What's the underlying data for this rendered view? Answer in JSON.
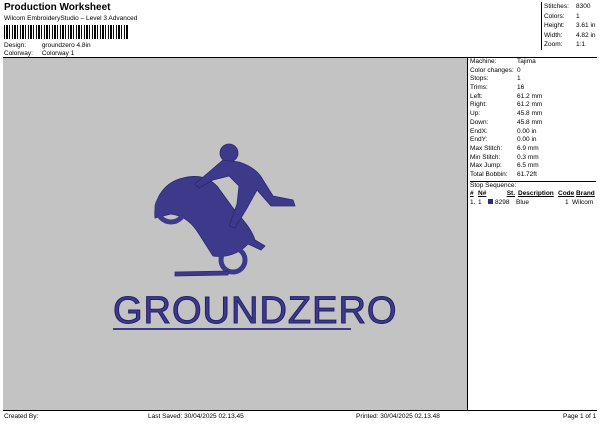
{
  "header": {
    "title": "Production Worksheet",
    "subtitle": "Wilcom EmbroideryStudio – Level 3 Advanced",
    "design_label": "Design:",
    "design_value": "groundzero 4.8in",
    "colorway_label": "Colorway:",
    "colorway_value": "Colorway 1"
  },
  "stats": [
    {
      "label": "Stitches:",
      "value": "8300"
    },
    {
      "label": "Colors:",
      "value": "1"
    },
    {
      "label": "Height:",
      "value": "3.61 in"
    },
    {
      "label": "Width:",
      "value": "4.82 in"
    },
    {
      "label": "Zoom:",
      "value": "1:1"
    }
  ],
  "design": {
    "logo_text": "GROUNDZERO",
    "thread_color": "#3d3a8c",
    "canvas_color": "#c3c3c3"
  },
  "properties": [
    {
      "label": "Machine:",
      "value": "Tajima"
    },
    {
      "label": "Color changes:",
      "value": "0"
    },
    {
      "label": "Stops:",
      "value": "1"
    },
    {
      "label": "Trims:",
      "value": "16"
    },
    {
      "label": "Left:",
      "value": "61.2 mm"
    },
    {
      "label": "Right:",
      "value": "61.2 mm"
    },
    {
      "label": "Up:",
      "value": "45.8 mm"
    },
    {
      "label": "Down:",
      "value": "45.8 mm"
    },
    {
      "label": "EndX:",
      "value": "0.00 in"
    },
    {
      "label": "EndY:",
      "value": "0.00 in"
    },
    {
      "label": "Max Stitch:",
      "value": "6.9 mm"
    },
    {
      "label": "Min Stitch:",
      "value": "0.3 mm"
    },
    {
      "label": "Max Jump:",
      "value": "6.5 mm"
    },
    {
      "label": "Total Bobbin:",
      "value": "61.72ft"
    }
  ],
  "stop_sequence": {
    "title": "Stop Sequence:",
    "columns": [
      "#",
      "N#",
      "St.",
      "Description",
      "Code",
      "Brand"
    ],
    "rows": [
      {
        "num": "1.",
        "n": "1",
        "swatch": "#2e2b7a",
        "st": "8298",
        "description": "Blue",
        "code": "1",
        "brand": "Wilcom"
      }
    ]
  },
  "footer": {
    "created_by": "Created By:",
    "last_saved": "Last Saved: 30/04/2025 02.13.45",
    "printed": "Printed: 30/04/2025 02.13.48",
    "page": "Page 1 of 1"
  }
}
